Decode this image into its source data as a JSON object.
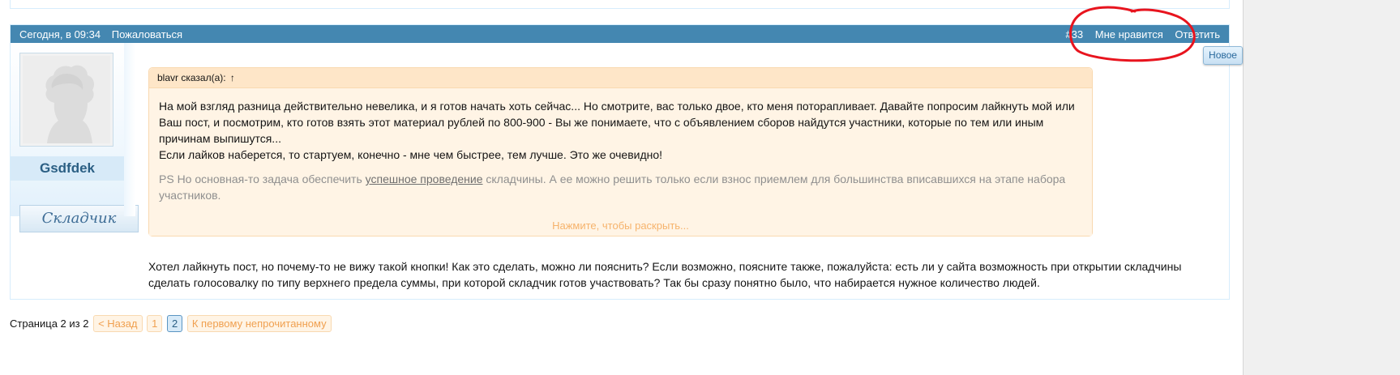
{
  "post": {
    "date": "Сегодня, в 09:34",
    "report_label": "Пожаловаться",
    "post_number": "#33",
    "like_label": "Мне нравится",
    "reply_label": "Ответить",
    "new_badge": "Новое"
  },
  "author": {
    "username": "Gsdfdek",
    "title": "Складчик"
  },
  "quote": {
    "header_author": "blavr сказал(а):",
    "header_arrow": "↑",
    "paragraph_1": "На мой взгляд разница действительно невелика, и я готов начать хоть сейчас... Но смотрите, вас только двое, кто меня поторапливает. Давайте попросим лайкнуть мой или Ваш пост, и посмотрим, кто готов взять этот материал рублей по 800-900 - Вы же понимаете, что с объявлением сборов найдутся участники, которые по тем или иным причинам выпишутся...",
    "paragraph_2": "Если лайков наберется, то стартуем, конечно - мне чем быстрее, тем лучше. Это же очевидно!",
    "ps_before": "PS Но основная-то задача обеспечить ",
    "ps_link": "успешное проведение",
    "ps_after": " складчины. А ее можно решить только если взнос приемлем для большинства вписавшихся на этапе набора участников.",
    "expand_label": "Нажмите, чтобы раскрыть..."
  },
  "message": {
    "text": "Хотел лайкнуть пост, но почему-то не вижу такой кнопки! Как это сделать, можно ли пояснить? Если возможно, поясните также, пожалуйста: есть ли у сайта возможность при открытии складчины сделать голосовалку по типу верхнего предела суммы, при которой складчик готов участвовать? Так бы сразу понятно было, что набирается нужное количество людей."
  },
  "pagination": {
    "label": "Страница 2 из 2",
    "prev_label": "< Назад",
    "pages": [
      "1",
      "2"
    ],
    "current_page": "2",
    "first_unread_label": "К первому непрочитанному"
  },
  "colors": {
    "header_bar": "#4487b1",
    "quote_bg": "#fff4e5",
    "quote_border": "#f9d9b0",
    "username": "#2b5f84",
    "annotation_circle": "#e8141e"
  },
  "icons": {
    "avatar": "default-avatar-silhouette-icon",
    "quote_arrow": "up-arrow-icon"
  },
  "annotation": {
    "type": "hand-drawn circle",
    "target": "post actions: #33 / Мне нравится / Ответить"
  }
}
